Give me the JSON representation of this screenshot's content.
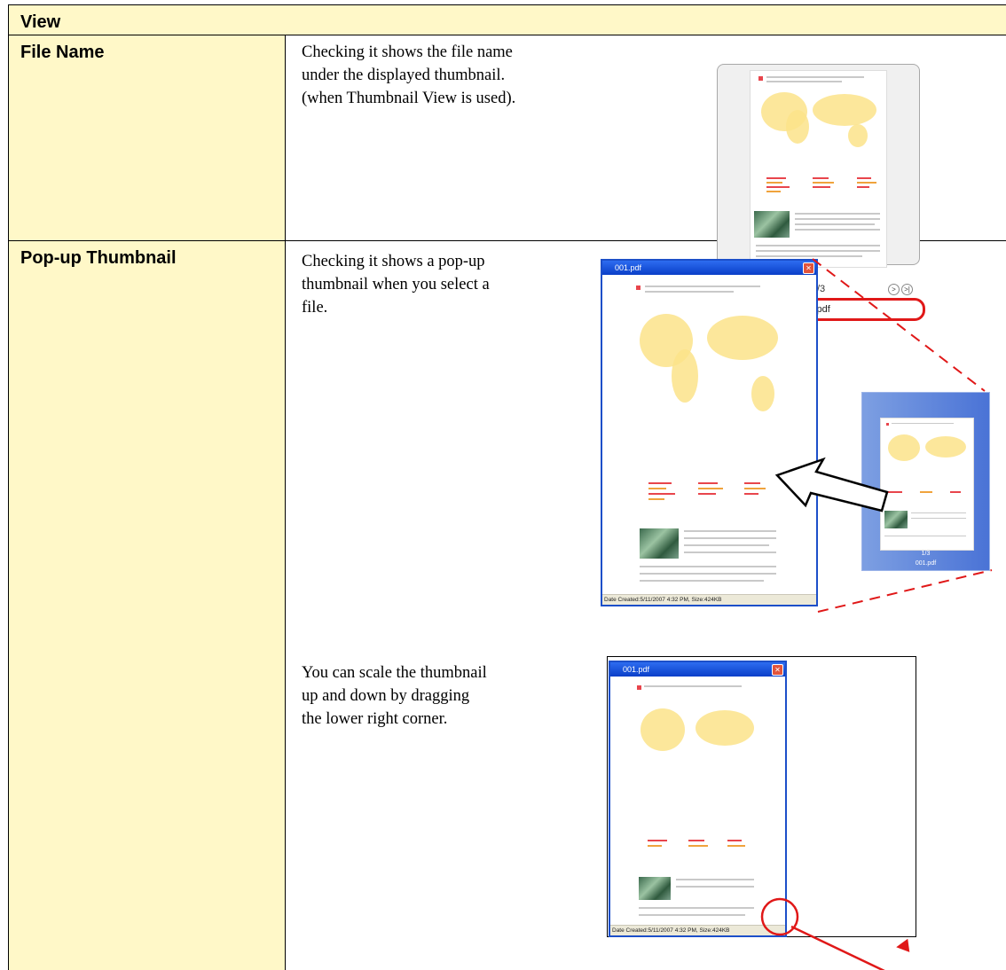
{
  "header": {
    "title": "View"
  },
  "rows": [
    {
      "label": "File Name",
      "description": [
        "Checking it shows the file name",
        "under the displayed thumbnail.",
        "(when Thumbnail View is used)."
      ],
      "viewer": {
        "page_counter": "1/3",
        "file_name": "001.pdf"
      }
    },
    {
      "label": "Pop-up Thumbnail",
      "description": [
        "Checking it shows a pop-up",
        "thumbnail when you select a",
        "file."
      ],
      "description2": [
        "You can scale the thumbnail",
        "up and down by dragging",
        "the lower right corner."
      ],
      "popup": {
        "title": "001.pdf",
        "status": "Date Created:5/11/2007 4:32 PM, Size:424KB"
      },
      "mini_viewer": {
        "page_counter": "1/3",
        "file_name": "001.pdf"
      }
    }
  ],
  "colors": {
    "label_bg": "#fff8c8",
    "highlight": "#e01818",
    "popup_border": "#1c4fc9"
  }
}
